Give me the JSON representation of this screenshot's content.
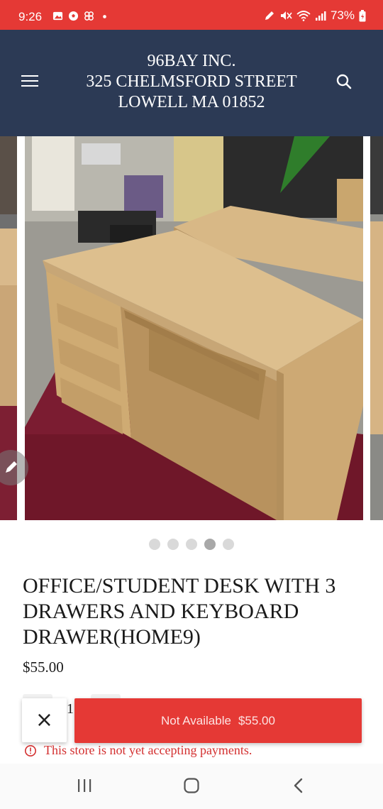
{
  "status_bar": {
    "time": "9:26",
    "battery": "73%",
    "left_icons": [
      "gallery-icon",
      "soccer-ball-icon",
      "pinwheel-icon",
      "notification-dot"
    ],
    "right_icons": [
      "pen-icon",
      "mute-icon",
      "wifi-icon",
      "signal-icon",
      "battery-icon"
    ]
  },
  "header": {
    "store_line1": "96BAY INC.",
    "store_line2": "325 CHELMSFORD STREET",
    "store_line3": "LOWELL MA 01852",
    "menu_icon": "hamburger-menu-icon",
    "search_icon": "search-icon",
    "background_color": "#2c3a55"
  },
  "carousel": {
    "slide_count": 5,
    "active_index": 3
  },
  "product": {
    "title": "OFFICE/STUDENT DESK WITH 3 DRAWERS AND KEYBOARD DRAWER(HOME9)",
    "price": "$55.00",
    "quantity": "1"
  },
  "actions": {
    "close_label": "×",
    "add_label": "Not Available",
    "add_price": "$55.00",
    "button_color": "#e53935"
  },
  "notice": {
    "text": "This store is not yet accepting payments.",
    "color": "#d32f2f"
  },
  "nav_bar": {
    "icons": [
      "recents-icon",
      "home-icon",
      "back-icon"
    ]
  }
}
